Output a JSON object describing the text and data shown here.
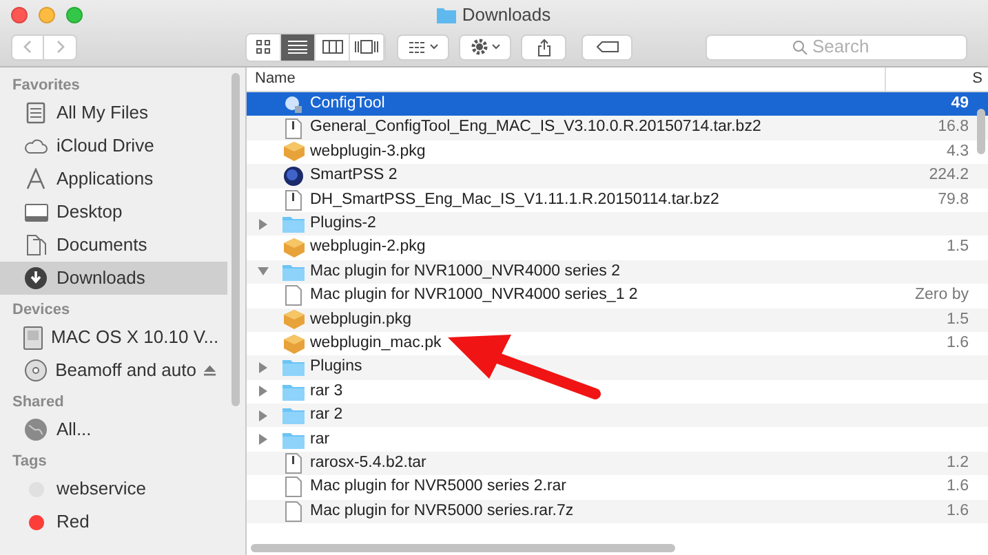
{
  "window": {
    "title": "Downloads"
  },
  "toolbar": {
    "view_buttons": [
      {
        "kind": "icons",
        "selected": false
      },
      {
        "kind": "list",
        "selected": true
      },
      {
        "kind": "columns",
        "selected": false
      },
      {
        "kind": "coverflow",
        "selected": false
      }
    ],
    "search": {
      "placeholder": "Search"
    }
  },
  "sidebar": [
    {
      "heading": "Favorites",
      "items": [
        {
          "kind": "files",
          "label": "All My Files",
          "selected": false
        },
        {
          "kind": "cloud",
          "label": "iCloud Drive",
          "selected": false
        },
        {
          "kind": "apps",
          "label": "Applications",
          "selected": false
        },
        {
          "kind": "desktop",
          "label": "Desktop",
          "selected": false
        },
        {
          "kind": "documents",
          "label": "Documents",
          "selected": false
        },
        {
          "kind": "downloads",
          "label": "Downloads",
          "selected": true
        }
      ]
    },
    {
      "heading": "Devices",
      "items": [
        {
          "kind": "disk",
          "label": "MAC OS X 10.10 V...",
          "selected": false
        },
        {
          "kind": "disc",
          "label": "Beamoff and auto",
          "selected": false,
          "eject": true
        }
      ]
    },
    {
      "heading": "Shared",
      "items": [
        {
          "kind": "network",
          "label": "All...",
          "selected": false
        }
      ]
    },
    {
      "heading": "Tags",
      "items": [
        {
          "kind": "tag",
          "label": "webservice",
          "selected": false,
          "color": "#e0e0e0"
        },
        {
          "kind": "tag",
          "label": "Red",
          "selected": false,
          "color": "#fc3d39"
        }
      ]
    }
  ],
  "table": {
    "columns": [
      "Name",
      "S"
    ],
    "rows": [
      {
        "kind": "app",
        "name": "ConfigTool",
        "size": "49",
        "selected": true
      },
      {
        "kind": "archive",
        "name": "General_ConfigTool_Eng_MAC_IS_V3.10.0.R.20150714.tar.bz2",
        "size": "16.8",
        "selected": false
      },
      {
        "kind": "package",
        "name": "webplugin-3.pkg",
        "size": "4.3",
        "selected": false
      },
      {
        "kind": "globe-app",
        "name": "SmartPSS 2",
        "size": "224.2",
        "selected": false
      },
      {
        "kind": "archive",
        "name": "DH_SmartPSS_Eng_Mac_IS_V1.11.1.R.20150114.tar.bz2",
        "size": "79.8",
        "selected": false
      },
      {
        "kind": "folder",
        "name": "Plugins-2",
        "expanded": false,
        "selected": false
      },
      {
        "kind": "package",
        "name": "webplugin-2.pkg",
        "size": "1.5",
        "selected": false
      },
      {
        "kind": "folder",
        "name": "Mac plugin for NVR1000_NVR4000 series 2",
        "expanded": true,
        "selected": false
      },
      {
        "kind": "document",
        "name": "Mac plugin for NVR1000_NVR4000 series_1 2",
        "size": "Zero by",
        "selected": false
      },
      {
        "kind": "package",
        "name": "webplugin.pkg",
        "size": "1.5",
        "selected": false
      },
      {
        "kind": "package",
        "name": "webplugin_mac.pk",
        "size": "1.6",
        "selected": false
      },
      {
        "kind": "folder",
        "name": "Plugins",
        "expanded": false,
        "selected": false
      },
      {
        "kind": "folder",
        "name": "rar 3",
        "expanded": false,
        "selected": false
      },
      {
        "kind": "folder",
        "name": "rar 2",
        "expanded": false,
        "selected": false
      },
      {
        "kind": "folder",
        "name": "rar",
        "expanded": false,
        "selected": false
      },
      {
        "kind": "archive",
        "name": "rarosx-5.4.b2.tar",
        "size": "1.2",
        "selected": false
      },
      {
        "kind": "document",
        "name": "Mac plugin for NVR5000 series 2.rar",
        "size": "1.6",
        "selected": false
      },
      {
        "kind": "document",
        "name": "Mac plugin for NVR5000 series.rar.7z",
        "size": "1.6",
        "selected": false
      }
    ]
  }
}
